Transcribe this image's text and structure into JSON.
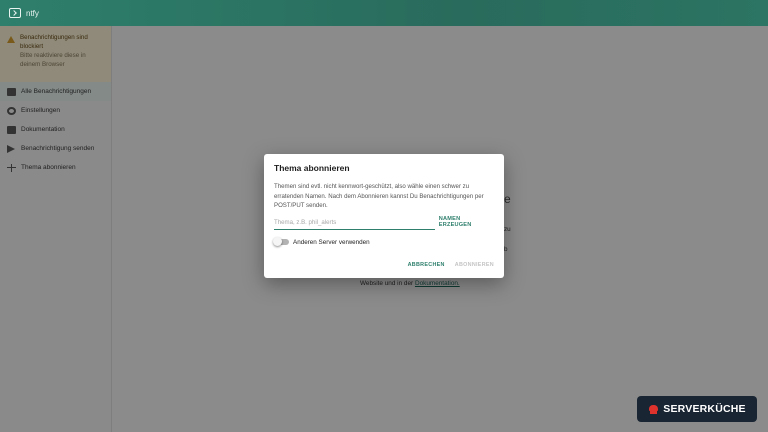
{
  "app": {
    "title": "ntfy"
  },
  "sidebar": {
    "warning": {
      "line1": "Benachrichtigungen sind blockiert",
      "line2": "Bitte reaktiviere diese in deinem Browser"
    },
    "items": [
      {
        "label": "Alle Benachrichtigungen",
        "icon": "chat-icon",
        "active": true
      },
      {
        "label": "Einstellungen",
        "icon": "gear-icon"
      },
      {
        "label": "Dokumentation",
        "icon": "doc-icon"
      },
      {
        "label": "Benachrichtigung senden",
        "icon": "send-icon"
      },
      {
        "label": "Thema abonnieren",
        "icon": "plus-icon"
      }
    ]
  },
  "background": {
    "fragment_e": "e",
    "fragment_zu": "zu",
    "fragment_b": "b",
    "link_prefix": "Website und in der ",
    "link_text": "Dokumentation."
  },
  "dialog": {
    "title": "Thema abonnieren",
    "description": "Themen sind evtl. nicht kennwort-geschützt, also wähle einen schwer zu erratenden Namen. Nach dem Abonnieren kannst Du Benachrichtigungen per POST/PUT senden.",
    "input_placeholder": "Thema, z.B. phil_alerts",
    "input_value": "",
    "generate_label": "NAMEN ERZEUGEN",
    "switch_label": "Anderen Server verwenden",
    "switch_on": false,
    "cancel_label": "ABBRECHEN",
    "subscribe_label": "ABONNIEREN"
  },
  "watermark": {
    "text": "SERVERKÜCHE"
  },
  "colors": {
    "accent": "#2e7f6c",
    "appbar": "#2e7f6c",
    "badge_bg": "#1a2533",
    "badge_icon": "#e0322d"
  }
}
